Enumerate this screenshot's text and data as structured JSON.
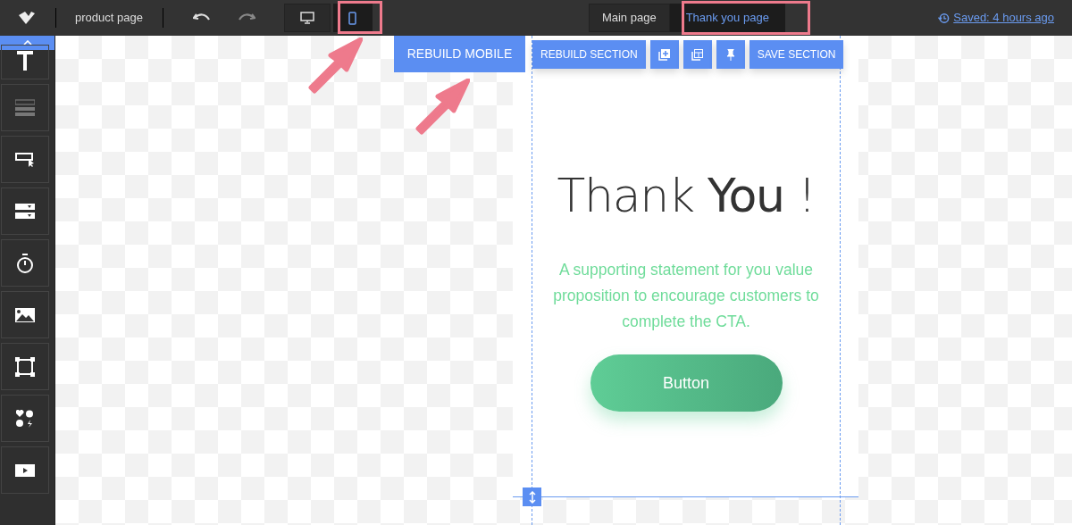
{
  "topbar": {
    "project_name": "product page",
    "devices": [
      {
        "kind": "desktop",
        "selected": false
      },
      {
        "kind": "mobile",
        "selected": true
      }
    ],
    "pages": [
      {
        "label": "Main page",
        "selected": false
      },
      {
        "label": "Thank you page",
        "selected": true
      }
    ],
    "saved": "Saved: 4 hours ago"
  },
  "sidebar": {
    "tools": [
      {
        "kind": "text"
      },
      {
        "kind": "rows"
      },
      {
        "kind": "button"
      },
      {
        "kind": "form"
      },
      {
        "kind": "timer"
      },
      {
        "kind": "image"
      },
      {
        "kind": "shape"
      },
      {
        "kind": "icons"
      },
      {
        "kind": "video"
      }
    ]
  },
  "canvas": {
    "rebuild_mobile": "REBUILD MOBILE",
    "section_toolbar": [
      {
        "kind": "text",
        "label": "REBUILD SECTION"
      },
      {
        "kind": "add"
      },
      {
        "kind": "duplicate"
      },
      {
        "kind": "pin"
      },
      {
        "kind": "text",
        "label": "SAVE SECTION"
      }
    ],
    "heading": "Thank **You** !",
    "statement": "A supporting statement for you value proposition to encourage customers to complete the CTA.",
    "cta": "Button"
  }
}
